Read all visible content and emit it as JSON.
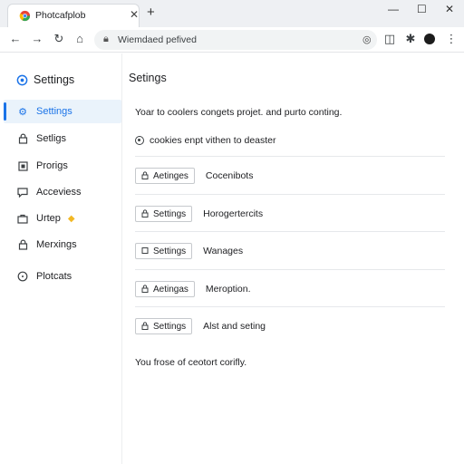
{
  "browser": {
    "tab_title": "Photcafplob",
    "url": "Wiemdaed pefived",
    "colors": {
      "accent": "#1a73e8",
      "tab_strip": "#eef0f3",
      "badge": "#f2b824"
    },
    "icons": {
      "close_tab": "close-icon",
      "new_tab": "plus-icon",
      "minimize": "minimize-icon",
      "maximize": "maximize-icon",
      "close_window": "close-icon",
      "back": "back-arrow-icon",
      "forward": "forward-arrow-icon",
      "reload": "reload-icon",
      "home": "home-icon"
    }
  },
  "sidebar": {
    "app_title": "Settings",
    "items": [
      {
        "label": "Settings",
        "icon": "gear-icon",
        "active": true
      },
      {
        "label": "Setligs",
        "icon": "lock-icon",
        "active": false
      },
      {
        "label": "Prorigs",
        "icon": "square-icon",
        "active": false
      },
      {
        "label": "Acceviess",
        "icon": "chat-icon",
        "active": false
      },
      {
        "label": "Urtep",
        "icon": "briefcase-icon",
        "active": false,
        "badge": "diamond"
      },
      {
        "label": "Merxings",
        "icon": "lock-icon",
        "active": false
      },
      {
        "label": "Plotcats",
        "icon": "clock-icon",
        "active": false
      }
    ]
  },
  "main": {
    "title": "Setings",
    "description": "Yoar to coolers congets projet. and purto conting.",
    "radio_label": "cookies enpt vithen to deaster",
    "rows": [
      {
        "button": "Aetinges",
        "label": "Cocenibots"
      },
      {
        "button": "Settings",
        "label": "Horogertercits"
      },
      {
        "button": "Settings",
        "label": "Wanages"
      },
      {
        "button": "Aetingas",
        "label": "Meroption."
      },
      {
        "button": "Settings",
        "label": "Alst and seting"
      }
    ],
    "footer": "You frose of ceotort corifly."
  }
}
